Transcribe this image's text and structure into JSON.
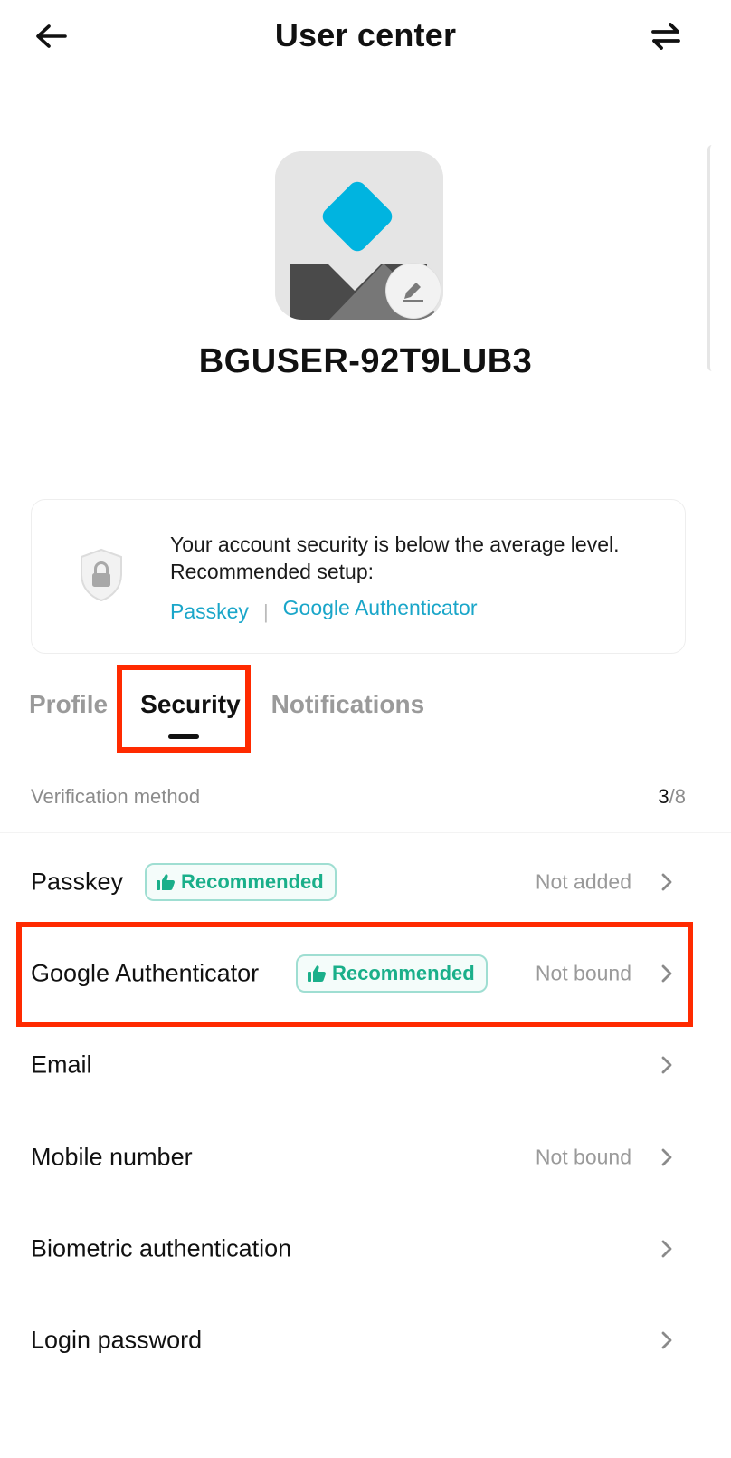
{
  "header": {
    "title": "User center"
  },
  "profile": {
    "username": "BGUSER-92T9LUB3"
  },
  "security_card": {
    "message_line1": "Your account security is below the average level.",
    "message_line2": "Recommended setup:",
    "links": [
      "Passkey",
      "Google Authenticator"
    ],
    "separator": "|"
  },
  "tabs": [
    {
      "label": "Profile",
      "active": false
    },
    {
      "label": "Security",
      "active": true
    },
    {
      "label": "Notifications",
      "active": false
    }
  ],
  "section": {
    "label": "Verification method",
    "count_done": "3",
    "count_total": "/8"
  },
  "methods": [
    {
      "label": "Passkey",
      "badge": "Recommended",
      "status": "Not added"
    },
    {
      "label": "Google Authenticator",
      "badge": "Recommended",
      "status": "Not bound"
    },
    {
      "label": "Email",
      "badge": "",
      "status": ""
    },
    {
      "label": "Mobile number",
      "badge": "",
      "status": "Not bound"
    },
    {
      "label": "Biometric authentication",
      "badge": "",
      "status": ""
    },
    {
      "label": "Login password",
      "badge": "",
      "status": ""
    }
  ],
  "colors": {
    "accent_link": "#1aa6c9",
    "recommended_green": "#1aaf8a",
    "highlight_red": "#ff2a00",
    "avatar_diamond": "#00b4e0"
  },
  "icons": {
    "back": "arrow-left-icon",
    "switch": "swap-arrows-icon",
    "edit": "pencil-icon",
    "shield": "shield-lock-icon",
    "thumb": "thumbs-up-icon",
    "chevron": "chevron-right-icon"
  }
}
